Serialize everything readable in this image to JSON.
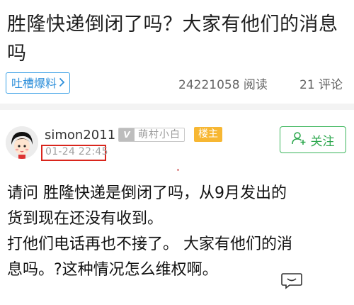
{
  "post": {
    "title": "胜隆快递倒闭了吗？大家有他们的消息吗",
    "tag_label": "吐槽爆料",
    "reads": "24221058 阅读",
    "comments": "21 评论"
  },
  "author": {
    "username": "simon2011",
    "level_icon": "V",
    "level_title": "萌村小白",
    "owner_label": "楼主",
    "timestamp": "01-24 22:45"
  },
  "follow": {
    "label": "关注"
  },
  "content": {
    "line1": "请问  胜隆快递是倒闭了吗，从9月发出的",
    "line2": "货到现在还没有收到。",
    "line3": "打他们电话再也不接了。 大家有他们的消",
    "line4": "息吗。?这种情况怎么维权啊。"
  },
  "colors": {
    "accent_blue": "#3aa0e6",
    "follow_green": "#3bb55b",
    "owner_badge": "#f7b733",
    "highlight_red": "#d9251c"
  },
  "icons": [
    "chevron-right-icon",
    "add-user-icon",
    "chat-bubble-icon",
    "verified-level-icon"
  ]
}
